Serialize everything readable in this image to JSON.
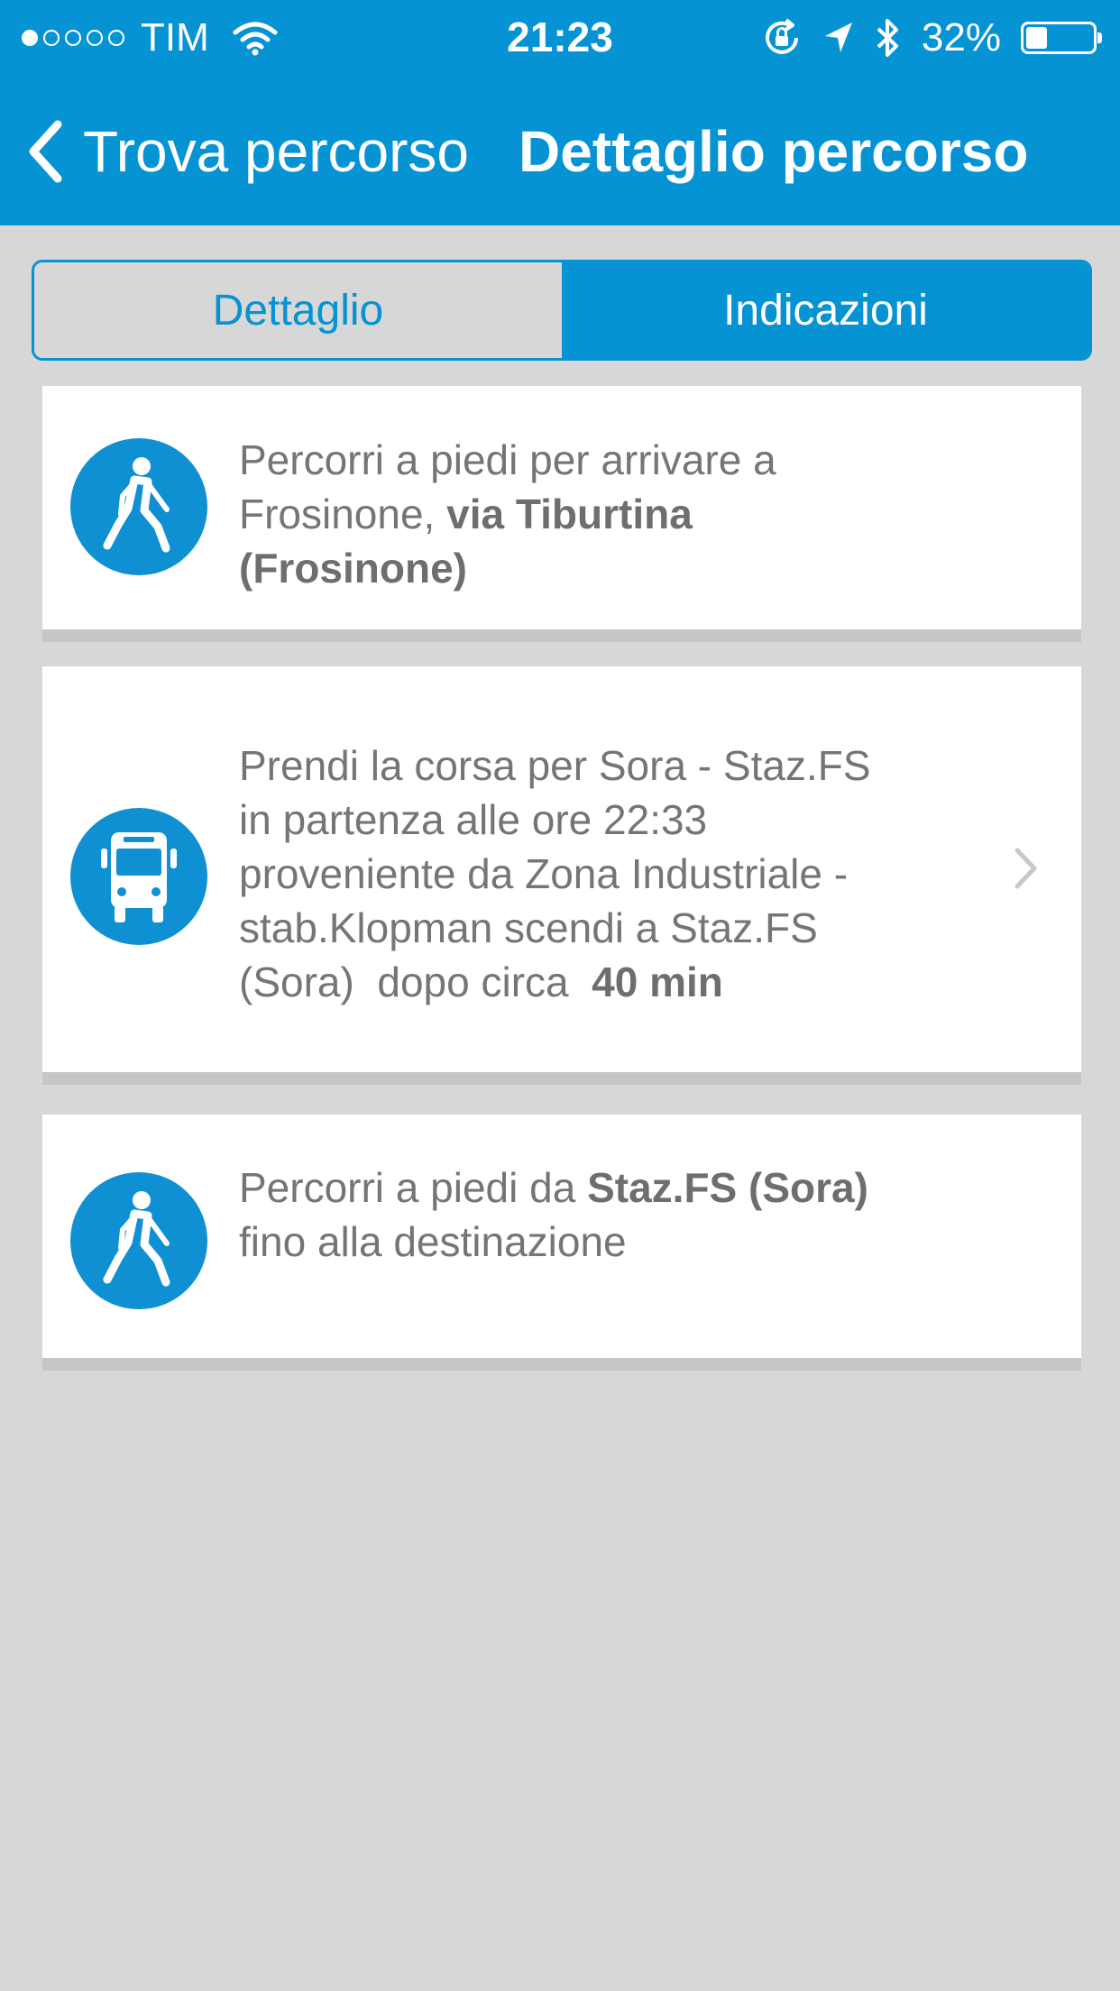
{
  "status_bar": {
    "signal_bars": 1,
    "signal_total": 5,
    "carrier": "TIM",
    "time": "21:23",
    "battery_percent_label": "32%",
    "battery_level": 0.32,
    "icons": [
      "wifi-icon",
      "rotation-lock-icon",
      "location-arrow-icon",
      "bluetooth-icon",
      "battery-icon"
    ]
  },
  "nav": {
    "back_label": "Trova percorso",
    "title": "Dettaglio percorso"
  },
  "tabs": [
    {
      "label": "Dettaglio",
      "selected": false
    },
    {
      "label": "Indicazioni",
      "selected": true
    }
  ],
  "steps": [
    {
      "icon": "walking-person-icon",
      "line1": "Percorri a piedi per arrivare a",
      "line2_plain": "Frosinone, ",
      "line2_bold": "via Tiburtina",
      "line3_bold": "(Frosinone)"
    },
    {
      "icon": "bus-icon",
      "line1": "Prendi la corsa per Sora - Staz.FS",
      "line2": "in partenza alle ore 22:33",
      "line3": "proveniente da Zona Industriale -",
      "line4": "stab.Klopman scendi a Staz.FS",
      "line5_plain": "(Sora)  dopo circa  ",
      "line5_bold": "40 min",
      "has_chevron": true
    },
    {
      "icon": "walking-person-icon",
      "line1_plain": "Percorri a piedi da ",
      "line1_bold": "Staz.FS (Sora)",
      "line2": "fino alla destinazione"
    }
  ],
  "colors": {
    "accent": "#0693d4",
    "background": "#d7d7d7",
    "card": "#ffffff",
    "text": "#757575"
  }
}
